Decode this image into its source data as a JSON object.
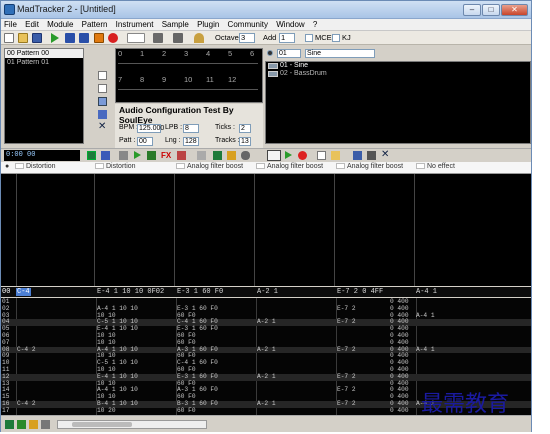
{
  "window": {
    "title": "MadTracker 2 - [Untitled]",
    "min": "–",
    "max": "□",
    "close": "✕"
  },
  "menu": [
    "File",
    "Edit",
    "Module",
    "Pattern",
    "Instrument",
    "Sample",
    "Plugin",
    "Community",
    "Window",
    "?"
  ],
  "toolbar": {
    "octave_label": "Octave :",
    "octave": "3",
    "add_label": "Add :",
    "add": "1",
    "mce_label": "MCE",
    "kj_label": "KJ"
  },
  "patterns": [
    {
      "num": "00",
      "name": "00 Pattern 00"
    },
    {
      "num": "01",
      "name": "01 Pattern 01"
    }
  ],
  "ruler": {
    "top": [
      "0",
      "1",
      "2",
      "3",
      "4",
      "5",
      "6"
    ],
    "bottom": [
      "7",
      "8",
      "9",
      "10",
      "11",
      "12"
    ]
  },
  "config": {
    "title": "Audio Configuration Test By SoulEye",
    "bpm_label": "BPM :",
    "bpm": "125.000",
    "lpb_label": "LPB :",
    "lpb": "8",
    "ticks_label": "Ticks :",
    "ticks": "2",
    "patt_label": "Patt :",
    "patt": "00",
    "lng_label": "Lng :",
    "lng": "128",
    "tracks_label": "Tracks :",
    "tracks": "13"
  },
  "instrument_select": {
    "num": "01",
    "name": "Sine"
  },
  "instruments": [
    "01 - Sine",
    "02 - BassDrum"
  ],
  "position": "0:00 00",
  "effects": [
    "Distortion",
    "Distortion",
    "Analog filter boost",
    "Analog filter boost",
    "Analog filter boost",
    "No effect"
  ],
  "chanrow": {
    "row": "00",
    "sel": "C-4",
    "cells": [
      "E-4 1 10 10 0F02",
      "E-3 1 60 F0",
      "A-2 1",
      "E-7 2 0 4FF",
      "A-4 1"
    ]
  },
  "pattern_rows": [
    {
      "n": "01",
      "c": [
        "",
        "",
        "",
        "",
        "",
        "",
        "0 400",
        ""
      ]
    },
    {
      "n": "02",
      "c": [
        "",
        "",
        "A-4 1 10 10",
        "E-3 1 60 F0",
        "",
        "E-7 2",
        "0 400",
        ""
      ]
    },
    {
      "n": "03",
      "c": [
        "",
        "",
        "10 10",
        "60 F0",
        "",
        "",
        "0 400",
        "A-4 1"
      ]
    },
    {
      "n": "04",
      "c": [
        "",
        "",
        "C-5 1 10 10",
        "C-4 1 60 F0",
        "A-2 1",
        "E-7 2",
        "0 400",
        ""
      ]
    },
    {
      "n": "05",
      "c": [
        "",
        "",
        "E-4 1 10 10",
        "E-3 1 60 F0",
        "",
        "",
        "0 400",
        ""
      ]
    },
    {
      "n": "06",
      "c": [
        "",
        "",
        "10 10",
        "60 F0",
        "",
        "",
        "0 400",
        ""
      ]
    },
    {
      "n": "07",
      "c": [
        "",
        "",
        "10 10",
        "60 F0",
        "",
        "",
        "0 400",
        ""
      ]
    },
    {
      "n": "08",
      "c": [
        "C-4 2",
        "",
        "A-4 1 10 10",
        "A-3 1 60 F0",
        "A-2 1",
        "E-7 2",
        "0 400",
        "A-4 1"
      ]
    },
    {
      "n": "09",
      "c": [
        "",
        "",
        "10 10",
        "60 F0",
        "",
        "",
        "0 400",
        ""
      ]
    },
    {
      "n": "10",
      "c": [
        "",
        "",
        "C-5 1 10 10",
        "C-4 1 60 F0",
        "",
        "",
        "0 400",
        ""
      ]
    },
    {
      "n": "11",
      "c": [
        "",
        "",
        "10 10",
        "60 F0",
        "",
        "",
        "0 400",
        ""
      ]
    },
    {
      "n": "12",
      "c": [
        "",
        "",
        "E-4 1 10 10",
        "E-3 1 60 F0",
        "A-2 1",
        "E-7 2",
        "0 400",
        ""
      ]
    },
    {
      "n": "13",
      "c": [
        "",
        "",
        "10 10",
        "60 F0",
        "",
        "",
        "0 400",
        ""
      ]
    },
    {
      "n": "14",
      "c": [
        "",
        "",
        "A-4 1 10 10",
        "A-3 1 60 F0",
        "",
        "E-7 2",
        "0 400",
        ""
      ]
    },
    {
      "n": "15",
      "c": [
        "",
        "",
        "10 10",
        "60 F0",
        "",
        "",
        "0 400",
        ""
      ]
    },
    {
      "n": "16",
      "c": [
        "C-4 2",
        "",
        "B-4 1 10 10",
        "B-3 1 60 F0",
        "A-2 1",
        "E-7 2",
        "0 400",
        "A-4 1"
      ]
    },
    {
      "n": "17",
      "c": [
        "",
        "",
        "10 20",
        "60 F0",
        "",
        "",
        "0 400",
        ""
      ]
    }
  ],
  "watermark": "最需教育"
}
